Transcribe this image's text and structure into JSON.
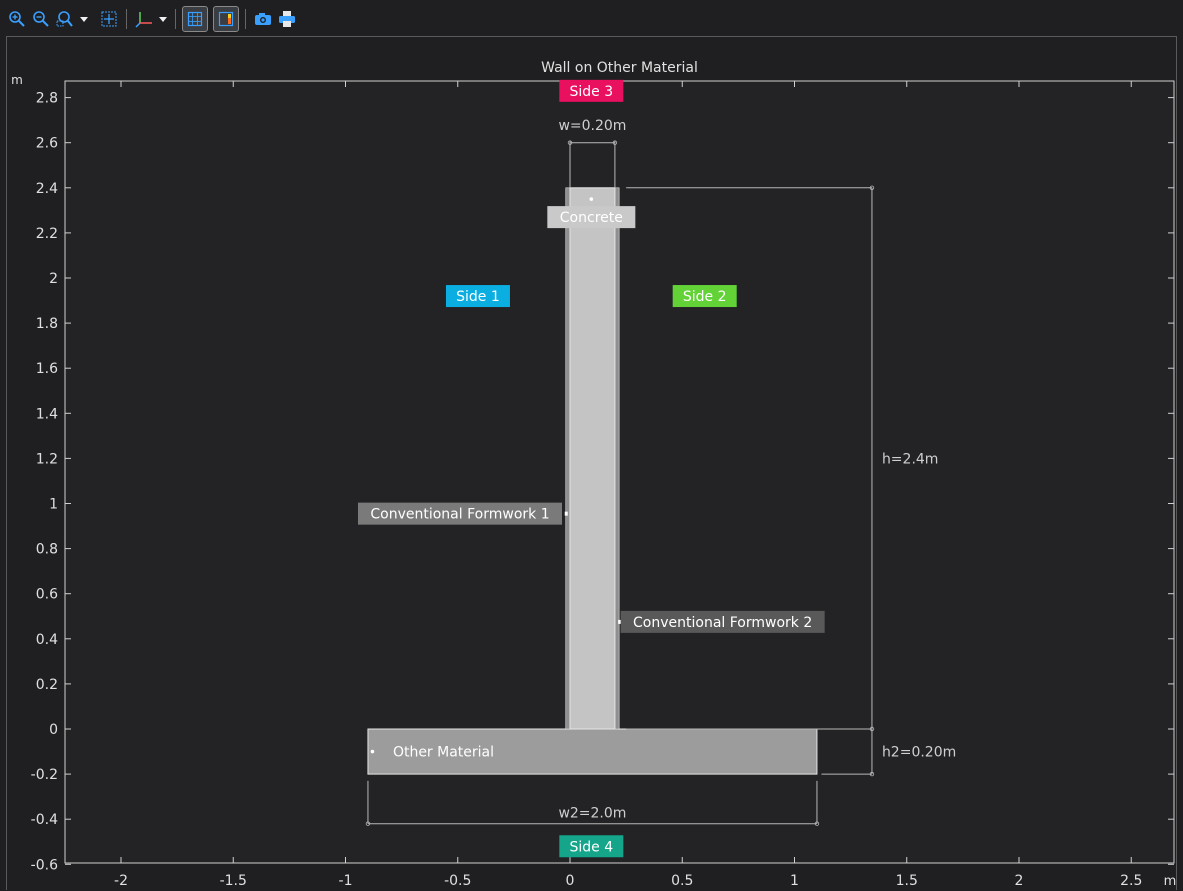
{
  "toolbar": {
    "buttons": [
      {
        "name": "zoom-in-icon"
      },
      {
        "name": "zoom-out-icon"
      },
      {
        "name": "zoom-box-icon"
      },
      {
        "name": "zoom-extents-icon"
      },
      {
        "name": "axis-orientation-icon"
      },
      {
        "name": "show-grid-icon",
        "toggled": true
      },
      {
        "name": "show-legend-icon",
        "toggled": true
      },
      {
        "name": "camera-icon"
      },
      {
        "name": "print-icon"
      }
    ]
  },
  "chart_data": {
    "type": "diagram",
    "title": "Wall on Other Material",
    "x_unit": "m",
    "y_unit": "m",
    "xlim": [
      -2.25,
      2.7
    ],
    "ylim": [
      -0.6,
      2.9
    ],
    "x_ticks": [
      "-2",
      "-1.5",
      "-1",
      "-0.5",
      "0",
      "0.5",
      "1",
      "1.5",
      "2",
      "2.5"
    ],
    "x_tick_values": [
      -2,
      -1.5,
      -1,
      -0.5,
      0,
      0.5,
      1,
      1.5,
      2,
      2.5
    ],
    "y_ticks": [
      "-0.6",
      "-0.4",
      "-0.2",
      "0",
      "0.2",
      "0.4",
      "0.6",
      "0.8",
      "1",
      "1.2",
      "1.4",
      "1.6",
      "1.8",
      "2",
      "2.2",
      "2.4",
      "2.6",
      "2.8"
    ],
    "y_tick_values": [
      -0.6,
      -0.4,
      -0.2,
      0,
      0.2,
      0.4,
      0.6,
      0.8,
      1,
      1.2,
      1.4,
      1.6,
      1.8,
      2,
      2.2,
      2.4,
      2.6,
      2.8
    ],
    "domains": [
      {
        "name": "Concrete",
        "x0": 0,
        "x1": 0.2,
        "y0": 0,
        "y1": 2.4,
        "color": "#c4c4c4"
      },
      {
        "name": "Other Material",
        "x0": -0.9,
        "x1": 1.1,
        "y0": -0.2,
        "y1": 0,
        "color": "#9c9c9c"
      }
    ],
    "formwork": [
      {
        "name": "Conventional Formwork 1",
        "x": -0.01,
        "y0": 0,
        "y1": 2.4
      },
      {
        "name": "Conventional Formwork 2",
        "x": 0.21,
        "y0": 0,
        "y1": 2.4
      }
    ],
    "labels": [
      {
        "text": "Side 3",
        "x": 0.095,
        "y": 2.83,
        "bg": "#e8105f",
        "fg": "#ffffff"
      },
      {
        "text": "Side 1",
        "x": -0.41,
        "y": 1.92,
        "bg": "#0aaee0",
        "fg": "#ffffff"
      },
      {
        "text": "Side 2",
        "x": 0.6,
        "y": 1.92,
        "bg": "#62d237",
        "fg": "#ffffff"
      },
      {
        "text": "Side 4",
        "x": 0.095,
        "y": -0.52,
        "bg": "#15a58a",
        "fg": "#ffffff"
      },
      {
        "text": "Concrete",
        "x": 0.095,
        "y": 2.27,
        "bg": "#c9c9c9",
        "fg": "#ffffff"
      },
      {
        "text": "Conventional Formwork 1",
        "x": -0.49,
        "y": 0.955,
        "bg": "#7a7a7a",
        "fg": "#ffffff"
      },
      {
        "text": "Conventional Formwork 2",
        "x": 0.68,
        "y": 0.475,
        "bg": "#595959",
        "fg": "#ffffff"
      }
    ],
    "dimensions": [
      {
        "text": "w=0.20m",
        "value": 0.2,
        "unit": "m"
      },
      {
        "text": "h=2.4m",
        "value": 2.4,
        "unit": "m"
      },
      {
        "text": "h2=0.20m",
        "value": 0.2,
        "unit": "m"
      },
      {
        "text": "w2=2.0m",
        "value": 2.0,
        "unit": "m"
      }
    ],
    "grid": false,
    "colors": {
      "background": "#232325",
      "axis": "#d0d0d0",
      "dimension": "#b8b8b8"
    }
  }
}
